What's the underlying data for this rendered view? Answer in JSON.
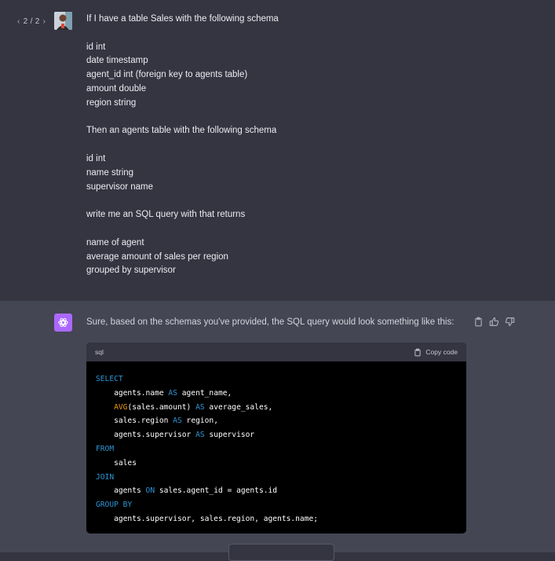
{
  "user": {
    "pagination": "2 / 2",
    "prev_arrow": "‹",
    "next_arrow": "›",
    "message_lines": [
      "If I have a table Sales with the following schema",
      "",
      "id int",
      "date timestamp",
      "agent_id int (foreign key to agents table)",
      "amount double",
      "region string",
      "",
      "Then an agents table with the following schema",
      "",
      "id int",
      "name string",
      "supervisor name",
      "",
      "write me an SQL query with that returns",
      "",
      "name of agent",
      "average amount of sales per region",
      "grouped by supervisor"
    ]
  },
  "assistant": {
    "intro": "Sure, based on the schemas you've provided, the SQL query would look something like this:",
    "code": {
      "language": "sql",
      "copy_label": "Copy code",
      "lines": [
        [
          {
            "t": "SELECT",
            "c": "kw"
          }
        ],
        [
          {
            "t": "    agents.name ",
            "c": ""
          },
          {
            "t": "AS",
            "c": "kw"
          },
          {
            "t": " agent_name,",
            "c": ""
          }
        ],
        [
          {
            "t": "    ",
            "c": ""
          },
          {
            "t": "AVG",
            "c": "fn2"
          },
          {
            "t": "(sales.amount) ",
            "c": ""
          },
          {
            "t": "AS",
            "c": "kw"
          },
          {
            "t": " average_sales,",
            "c": ""
          }
        ],
        [
          {
            "t": "    sales.region ",
            "c": ""
          },
          {
            "t": "AS",
            "c": "kw"
          },
          {
            "t": " region,",
            "c": ""
          }
        ],
        [
          {
            "t": "    agents.supervisor ",
            "c": ""
          },
          {
            "t": "AS",
            "c": "kw"
          },
          {
            "t": " supervisor",
            "c": ""
          }
        ],
        [
          {
            "t": "FROM",
            "c": "kw"
          }
        ],
        [
          {
            "t": "    sales",
            "c": ""
          }
        ],
        [
          {
            "t": "JOIN",
            "c": "kw"
          }
        ],
        [
          {
            "t": "    agents ",
            "c": ""
          },
          {
            "t": "ON",
            "c": "kw"
          },
          {
            "t": " sales.agent_id = agents.id",
            "c": ""
          }
        ],
        [
          {
            "t": "GROUP BY",
            "c": "kw"
          }
        ],
        [
          {
            "t": "    agents.supervisor, sales.region, agents.name;",
            "c": ""
          }
        ]
      ]
    }
  },
  "icons": [
    "chevron-left-icon",
    "chevron-right-icon",
    "user-avatar",
    "openai-logo-icon",
    "clipboard-icon",
    "thumbs-up-icon",
    "thumbs-down-icon"
  ],
  "colors": {
    "page_bg": "#343541",
    "assistant_bg": "#444654",
    "code_bg": "#000000",
    "keyword": "#2e95d3",
    "function": "#e9950c",
    "avatar_bg": "#ab68ff"
  }
}
